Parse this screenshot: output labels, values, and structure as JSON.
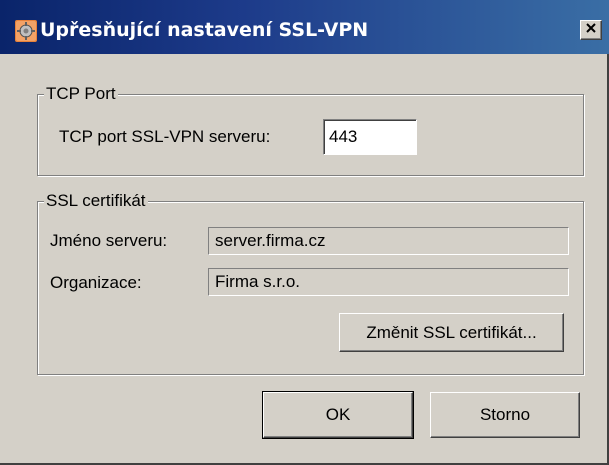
{
  "window": {
    "title": "Upřesňující nastavení SSL-VPN",
    "close_label": "×"
  },
  "tcp_group": {
    "legend": "TCP Port",
    "port_label": "TCP port SSL-VPN serveru:",
    "port_value": "443"
  },
  "ssl_group": {
    "legend": "SSL certifikát",
    "server_label": "Jméno serveru:",
    "server_value": "server.firma.cz",
    "org_label": "Organizace:",
    "org_value": "Firma s.r.o.",
    "change_button": "Změnit SSL certifikát..."
  },
  "footer": {
    "ok_button": "OK",
    "cancel_button": "Storno"
  }
}
